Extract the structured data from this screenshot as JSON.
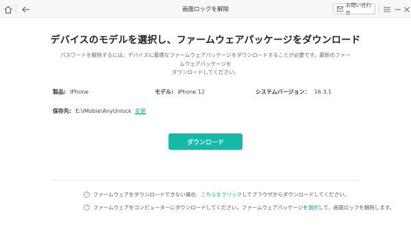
{
  "titlebar": {
    "title": "画面ロックを解除",
    "contact_label": "お問い合わせ",
    "icons": [
      "home-icon",
      "back-arrow-icon",
      "mail-icon",
      "menu-icon",
      "minimize-icon",
      "close-icon"
    ]
  },
  "main": {
    "title": "デバイスのモデルを選択し、ファームウェアパッケージをダウンロード",
    "description_line1": "パスワードを解除するには、デバイスに最適なファームウェアパッケージをダウンロードすることが必要です。最新のファームウェアパッケージを",
    "description_line2": "ダウンロードしてください。"
  },
  "device_info": {
    "product_label": "製品:",
    "product_value": "iPhone",
    "model_label": "モデル:",
    "model_value": "iPhone 12",
    "system_label": "システムバージョン：",
    "system_value": "16.3.1",
    "save_label": "保存先:",
    "save_value": "E:\\iMobie\\AnyUnlock",
    "change_label": "変更"
  },
  "download_button_label": "ダウンロード",
  "help": {
    "line1_pre": "ファームウェアをダウンロードできない場合、",
    "line1_link": "こちらをクリック",
    "line1_post": "してブラウザからダウンロードしてください。",
    "line2_pre": "ファームウェアをコンピューターにダウンロードしてください。ファームウェアパッケージを",
    "line2_link": "選択",
    "line2_post": "して、画面ロックを解除します。"
  },
  "colors": {
    "accent": "#16b8a8",
    "link": "#1ba9a0"
  }
}
